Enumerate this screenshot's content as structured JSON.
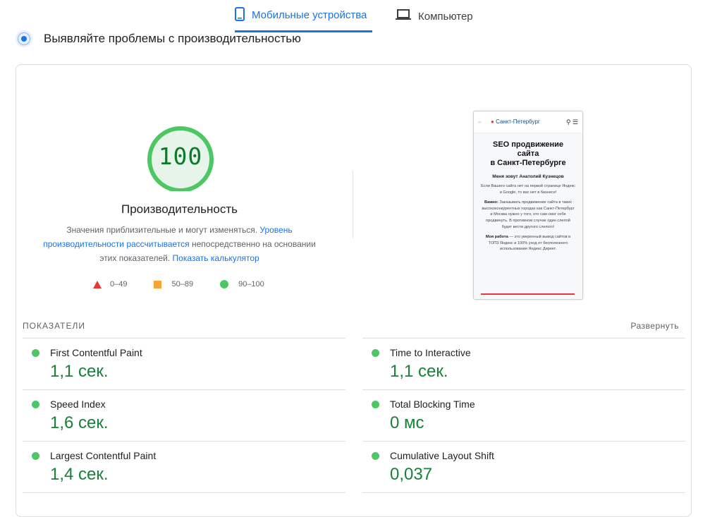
{
  "tabs": {
    "mobile_label": "Мобильные устройства",
    "desktop_label": "Компьютер"
  },
  "header": {
    "title": "Выявляйте проблемы с производительностью"
  },
  "performance": {
    "score": "100",
    "score_value": 100,
    "title": "Производительность",
    "desc_part1": "Значения приблизительные и могут изменяться. ",
    "desc_link1": "Уровень производительности рассчитывается",
    "desc_part2": " непосредственно на основании этих показателей. ",
    "desc_link2": "Показать калькулятор",
    "legend": {
      "fail": "0–49",
      "average": "50–89",
      "pass": "90–100"
    },
    "colors": {
      "pass": "#0c7a2b",
      "pass_dot": "#4cc764",
      "average": "#f4a533",
      "fail": "#e53935",
      "link": "#1a73e8"
    }
  },
  "screenshot": {
    "city": "Санкт-Петербург",
    "heading_line1": "SEO продвижение",
    "heading_line2": "сайта",
    "heading_line3": "в Санкт-Петербурге",
    "name": "Меня зовут Анатолий Кузнецов",
    "p1": "Если Вашего сайта нет на первой странице Яндекс и Google, то вас нет в бизнесе!",
    "p2_bold": "Важно:",
    "p2": " Заказывать продвижение сайта в таких высококонкурентных городах как Санкт-Петербург и Москва нужно у того, кто сам смог себя продвинуть. В противном случае один слепой будет вести другого слепого!",
    "p3_bold": "Моя работа",
    "p3": " — это уверенный вывод сайтов в ТОП3 Яндекс и 100% уход от бесполезного использования Яндекс Директ."
  },
  "metrics": {
    "heading": "ПОКАЗАТЕЛИ",
    "expand_label": "Развернуть",
    "items": [
      {
        "label": "First Contentful Paint",
        "value": "1,1 сек."
      },
      {
        "label": "Time to Interactive",
        "value": "1,1 сек."
      },
      {
        "label": "Speed Index",
        "value": "1,6 сек."
      },
      {
        "label": "Total Blocking Time",
        "value": "0 мс"
      },
      {
        "label": "Largest Contentful Paint",
        "value": "1,4 сек."
      },
      {
        "label": "Cumulative Layout Shift",
        "value": "0,037"
      }
    ]
  }
}
